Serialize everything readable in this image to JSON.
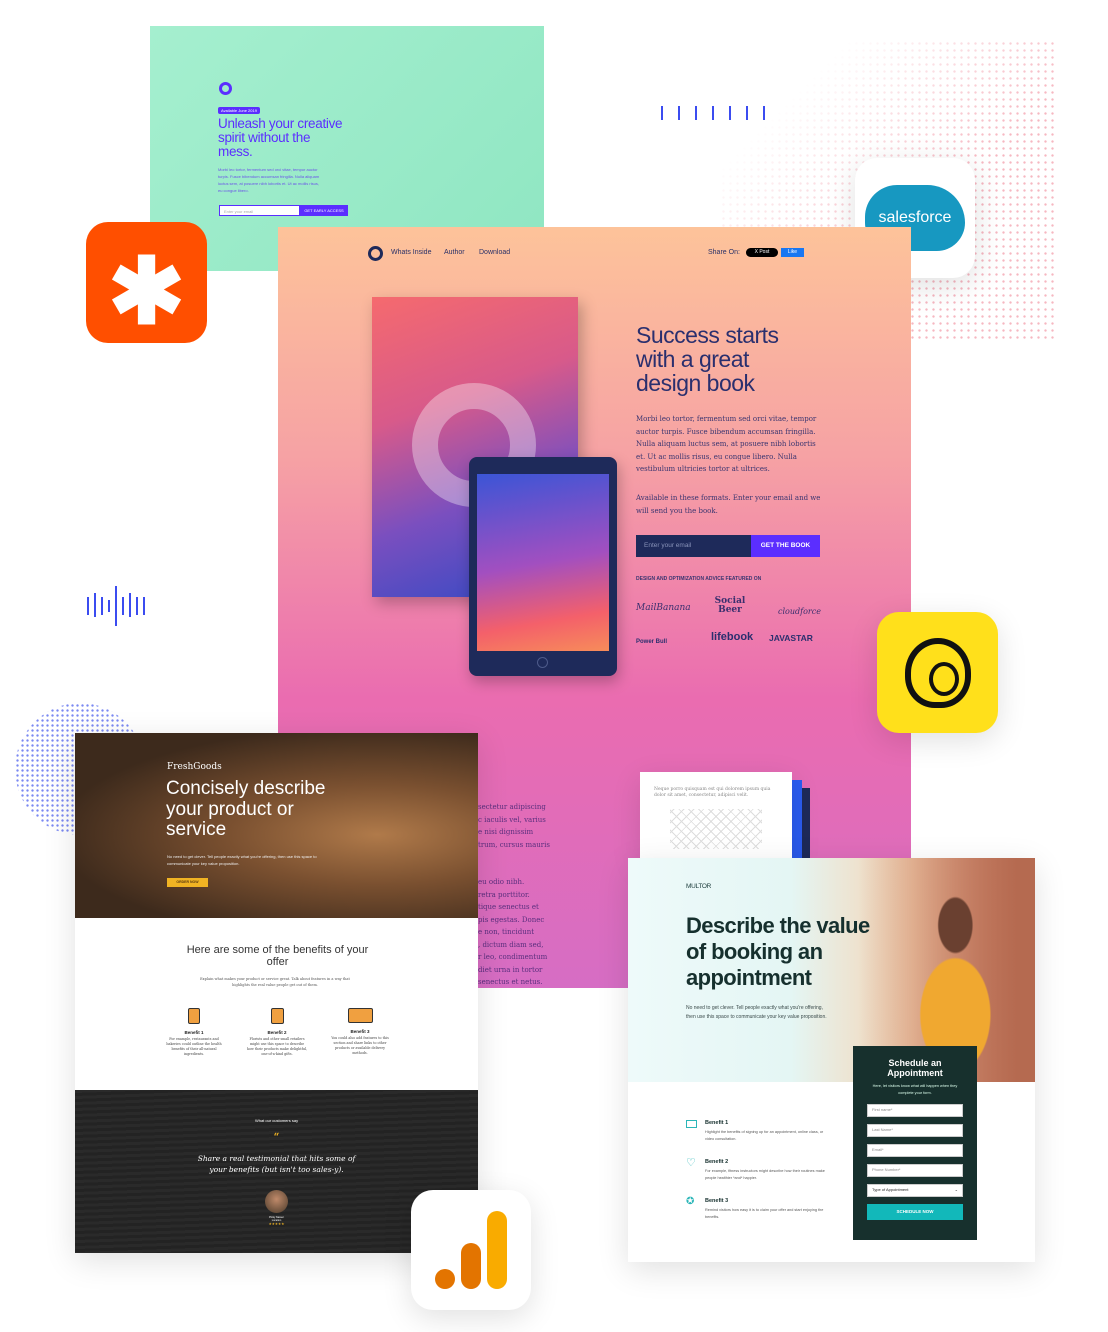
{
  "colors": {
    "zapier": "#FF4F00",
    "mailchimp": "#FFE01B",
    "salesforce": "#1798C1",
    "analytics": "#F9AB00",
    "accent_purple": "#5B2EFF",
    "navy": "#1E2A5A",
    "teal": "#12B8BA"
  },
  "green_page": {
    "badge": "Available June 2019",
    "headline": "Unleash your creative spirit without the mess.",
    "body": "Morbi leo tortor, fermentum sed orci vitae, tempor auctor turpis. Fusce bibendum accumsan fringilla. Nulla aliquam luctus sem, at posuere nibh lobortis et. Ut ac mollis risus, eu congue libero.",
    "email_placeholder": "Enter your email",
    "cta": "GET EARLY ACCESS"
  },
  "logos": {
    "salesforce": "salesforce",
    "zapier_icon": "asterisk-icon",
    "mailchimp_icon": "chimp-icon",
    "analytics_icon": "bar-chart-icon"
  },
  "book_page": {
    "nav": [
      "Whats Inside",
      "Author",
      "Download"
    ],
    "share_label": "Share On:",
    "x_post": "X Post",
    "fb_like": "Like",
    "headline": "Success starts with a great design book",
    "body": "Morbi leo tortor, fermentum sed orci vitae, tempor auctor turpis. Fusce bibendum accumsan fringilla. Nulla aliquam luctus sem, at posuere nibh lobortis et. Ut ac mollis risus, eu congue libero. Nulla vestibulum ultricies tortor at ultrices.",
    "formats": "Available in these formats. Enter your email and we will send you the book.",
    "email_placeholder": "Enter your email",
    "cta": "GET THE BOOK",
    "featured_label": "DESIGN AND OPTIMIZATION ADVICE FEATURED ON",
    "featured": [
      "MailBanana",
      "Social Beer",
      "cloudforce",
      "Power Bull",
      "lifebook",
      "JAVASTAR"
    ],
    "lower_text_1": [
      "sectetur adipiscing",
      "c iaculis vel, varius",
      "e nisi dignissim",
      "trum, cursus mauris"
    ],
    "lower_text_2": [
      "eu odio nibh.",
      "retra porttitor.",
      "tique senectus et",
      "pis egestas. Donec",
      "e non, tincidunt",
      ", dictum diam sed,",
      "r leo, condimentum",
      "diet urna in tortor",
      "senectus et netus."
    ],
    "doc_text": "Neque porro quisquam est qui dolorem ipsum quia dolor sit amet, consectetur, adipisci velit."
  },
  "fresh_page": {
    "brand": "FreshGoods",
    "headline": "Concisely describe your product or service",
    "sub": "No need to get clever. Tell people exactly what you're offering, then use this space to communicate your key value proposition.",
    "cta": "ORDER NOW",
    "benefits_title": "Here are some of the benefits of your offer",
    "benefits_sub": "Explain what makes your product or service great. Talk about features in a way that highlights the real value people get out of them.",
    "benefits": [
      {
        "title": "Benefit 1",
        "text": "For example, restaurants and bakeries could outline the health benefits of their all-natural ingredients."
      },
      {
        "title": "Benefit 2",
        "text": "Florists and other small retailers might use this space to describe how their products make delightful, one-of-a-kind gifts."
      },
      {
        "title": "Benefit 3",
        "text": "You could also add features to this section and share links to other products or available delivery methods."
      }
    ],
    "testimonial_label": "What our customers say",
    "quote_mark": "“",
    "testimonial": "Share a real testimonial that hits some of your benefits (but isn't too sales-y).",
    "person": "Pinky Nasser",
    "location": "Location",
    "stars": "★★★★★"
  },
  "multor_page": {
    "brand": "MULTOR",
    "headline": "Describe the value of booking an appointment",
    "sub": "No need to get clever. Tell people exactly what you're offering, then use this space to communicate your key value proposition.",
    "benefits": [
      {
        "title": "Benefit 1",
        "text": "Highlight the benefits of signing up for an appointment, online class, or video consultation."
      },
      {
        "title": "Benefit 2",
        "text": "For example, fitness instructors might describe how their routines make people healthier *and* happier."
      },
      {
        "title": "Benefit 3",
        "text": "Remind visitors how easy it is to claim your offer and start enjoying the benefits."
      }
    ],
    "form": {
      "title": "Schedule an Appointment",
      "sub": "Here, let visitors know what will happen when they complete your form.",
      "fields": [
        "First name*",
        "Last Name*",
        "Email*",
        "Phone Number*"
      ],
      "select": "Type of Appointment",
      "cta": "SCHEDULE NOW"
    }
  }
}
